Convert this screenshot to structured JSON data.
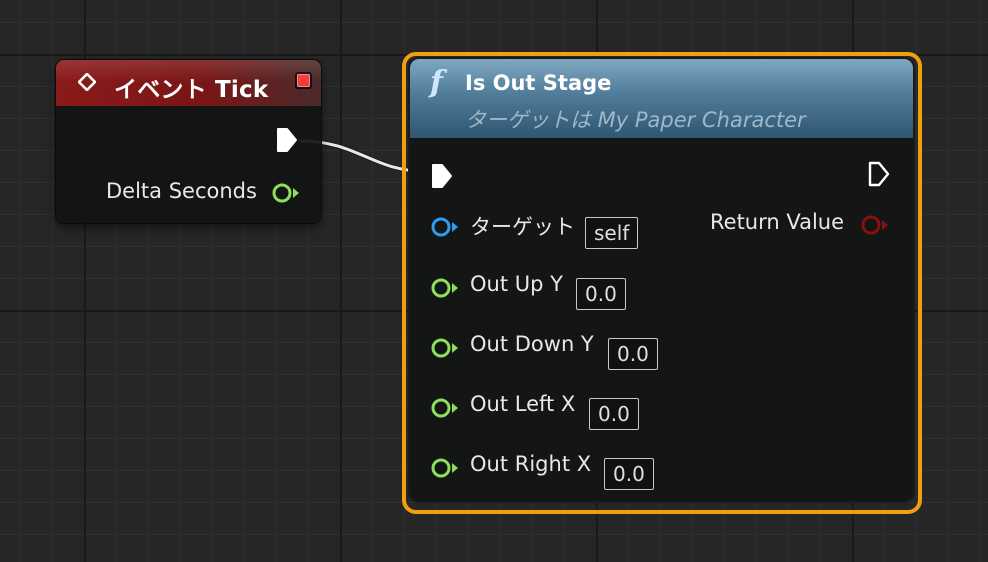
{
  "event_node": {
    "title": "イベント Tick",
    "output_pin_label": "Delta Seconds",
    "colors": {
      "header": "#8b1a1a",
      "float_pin": "#8ee05a",
      "stop_indicator": "#f33a3a"
    }
  },
  "function_node": {
    "icon": "function-icon",
    "title": "Is Out Stage",
    "subtitle": "ターゲットは My Paper Character",
    "inputs": [
      {
        "label": "ターゲット",
        "value": "self",
        "pin_color": "#2e9cf0"
      },
      {
        "label": "Out Up Y",
        "value": "0.0",
        "pin_color": "#8ee05a"
      },
      {
        "label": "Out Down Y",
        "value": "0.0",
        "pin_color": "#8ee05a"
      },
      {
        "label": "Out Left X",
        "value": "0.0",
        "pin_color": "#8ee05a"
      },
      {
        "label": "Out Right X",
        "value": "0.0",
        "pin_color": "#8ee05a"
      }
    ],
    "output_label": "Return Value",
    "colors": {
      "outline": "#f0a00e",
      "header": "#4f7c99",
      "return_pin": "#8a0f0f"
    }
  }
}
